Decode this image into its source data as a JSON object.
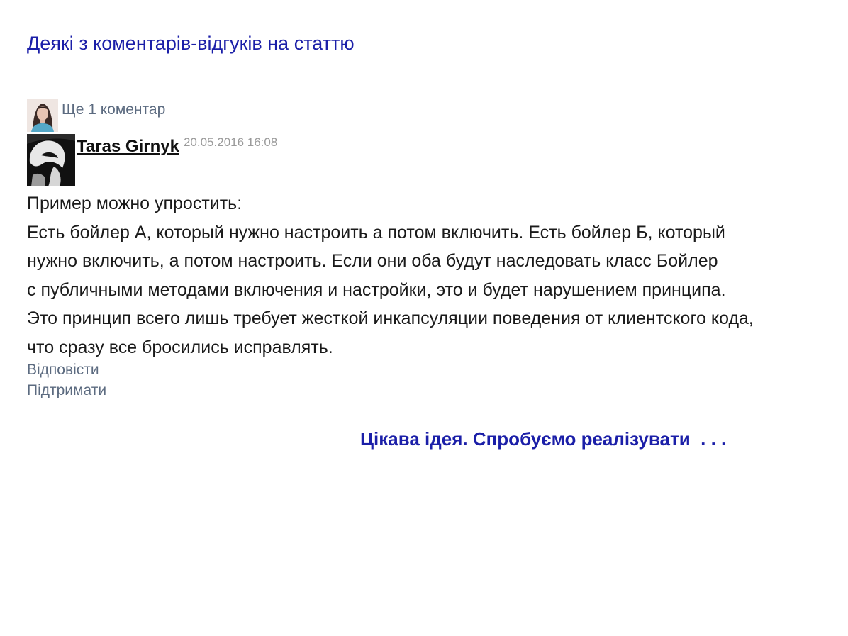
{
  "slide": {
    "title": "Деякі з коментарів-відгуків на статтю",
    "closing_note": "Цікава ідея. Спробуємо реалізувати  . . ."
  },
  "thread": {
    "more_comments_label": "Ще 1 коментар"
  },
  "comment": {
    "author": "Taras Girnyk",
    "date": "20.05.2016 16:08",
    "lines": [
      "Пример можно упростить:",
      "Есть бойлер А, который нужно настроить а потом включить. Есть бойлер Б, который",
      "нужно включить, а потом настроить. Если они оба будут наследовать класс Бойлер",
      "с публичными методами включения и настройки, это и будет нарушением принципа.",
      "Это принцип всего лишь требует жесткой инкапсуляции поведения от клиентского кода,",
      "что сразу все бросились исправлять."
    ],
    "reply_label": "Відповісти",
    "support_label": "Підтримати"
  },
  "colors": {
    "accent_blue": "#1b1fa8",
    "link_gray": "#5c6b80",
    "body_text": "#1a1a1a",
    "date_gray": "#9a9a9a"
  }
}
